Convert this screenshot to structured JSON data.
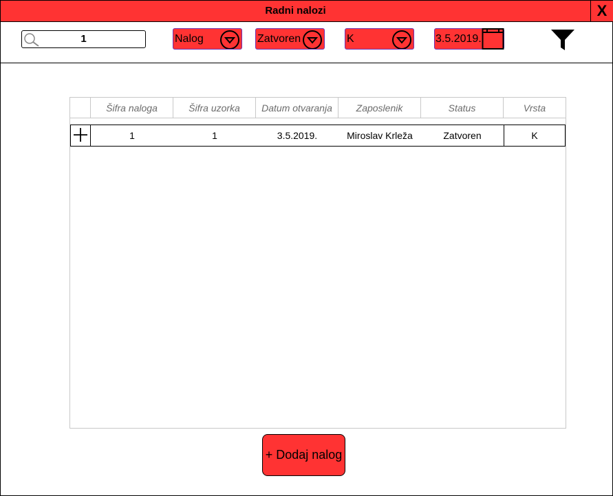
{
  "window": {
    "title": "Radni nalozi",
    "close_label": "X"
  },
  "toolbar": {
    "search_value": "1",
    "filter_type": "Nalog",
    "filter_status": "Zatvoren",
    "filter_kind": "K",
    "filter_date": "3.5.2019."
  },
  "table": {
    "columns": [
      "Šifra naloga",
      "Šifra uzorka",
      "Datum otvaranja",
      "Zaposlenik",
      "Status",
      "Vrsta"
    ],
    "rows": [
      {
        "sifra_naloga": "1",
        "sifra_uzorka": "1",
        "datum": "3.5.2019.",
        "zaposlenik": "Miroslav Krleža",
        "status": "Zatvoren",
        "vrsta": "K"
      }
    ]
  },
  "actions": {
    "add_label": "+ Dodaj nalog"
  },
  "colors": {
    "accent": "#ff3333",
    "dropdown_border": "#6a2fb0",
    "grid_line": "#c8c8c8"
  },
  "icons": [
    "search-icon",
    "dropdown-arrow-icon",
    "calendar-icon",
    "filter-icon",
    "plus-icon",
    "close-icon"
  ]
}
